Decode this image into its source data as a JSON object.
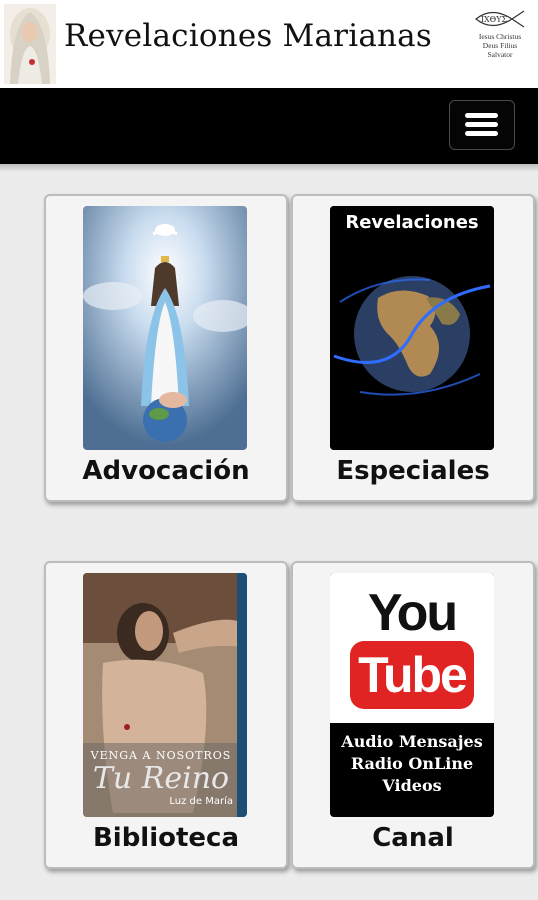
{
  "header": {
    "title": "Revelaciones Marianas",
    "emblem_word": "IXΘYΣ",
    "motto_line1": "Iesus Christus",
    "motto_line2": "Deus Filius Salvator"
  },
  "navbar": {
    "menu_icon": "hamburger-menu-icon"
  },
  "cards": [
    {
      "label": "Advocación",
      "image": "virgin-mary-image"
    },
    {
      "label": "Especiales",
      "image_title": "Revelaciones",
      "image": "earth-globe-image"
    },
    {
      "label": "Biblioteca",
      "image": "book-cover-image",
      "book_line1": "VENGA A NOSOTROS",
      "book_line2": "Tu Reino",
      "book_author": "Luz de María"
    },
    {
      "label": "Canal",
      "image": "youtube-image",
      "yt_you": "You",
      "yt_tube": "Tube",
      "yt_lines": [
        "Audio Mensajes",
        "Radio OnLine",
        "Videos"
      ]
    }
  ],
  "colors": {
    "navbar": "#000000",
    "background": "#ececec",
    "youtube_red": "#e02424"
  }
}
